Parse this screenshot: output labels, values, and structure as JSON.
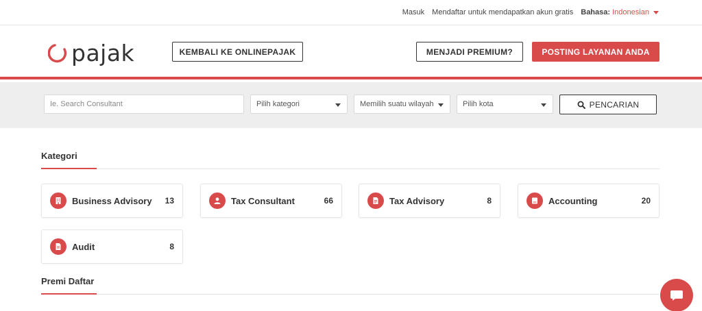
{
  "topbar": {
    "login": "Masuk",
    "register": "Mendaftar untuk mendapatkan akun gratis",
    "language_label": "Bahasa:",
    "language_value": "Indonesian"
  },
  "header": {
    "logo_text": "pajak",
    "back_button": "KEMBALI KE ONLINEPAJAK",
    "premium_button": "MENJADI PREMIUM?",
    "post_button": "POSTING LAYANAN ANDA"
  },
  "search": {
    "placeholder": "Ie. Search Consultant",
    "category_select": "Pilih kategori",
    "region_select": "Memilih suatu wilayah",
    "city_select": "Pilih kota",
    "search_button": "PENCARIAN"
  },
  "categories": {
    "title": "Kategori",
    "items": [
      {
        "name": "Business Advisory",
        "count": "13",
        "icon": "building-icon"
      },
      {
        "name": "Tax Consultant",
        "count": "66",
        "icon": "user-icon"
      },
      {
        "name": "Tax Advisory",
        "count": "8",
        "icon": "document-icon"
      },
      {
        "name": "Accounting",
        "count": "20",
        "icon": "book-icon"
      },
      {
        "name": "Audit",
        "count": "8",
        "icon": "file-icon"
      }
    ]
  },
  "premium": {
    "title": "Premi Daftar"
  },
  "colors": {
    "accent": "#d94b4b",
    "search_band": "#eeeeee"
  }
}
